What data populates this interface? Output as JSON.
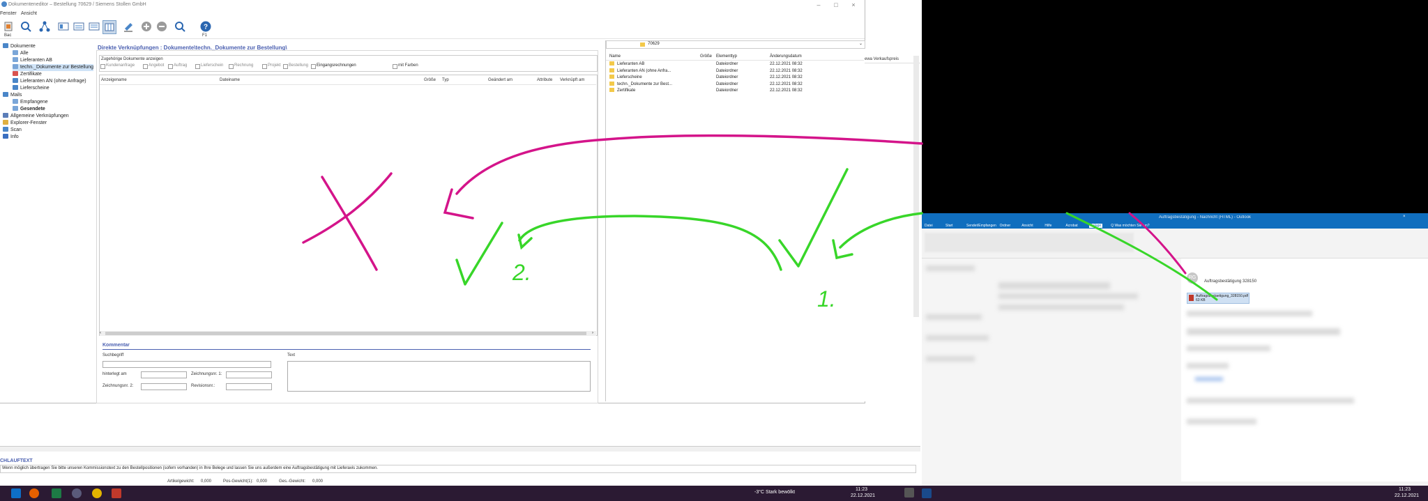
{
  "window": {
    "title": "Dokumenteneditor – Bestellung 70629 / Siemens Stollen GmbH",
    "menu": [
      "Fenster",
      "Ansicht"
    ],
    "toolbar_labels": {
      "bac": "Bac",
      "f1": "F1"
    }
  },
  "tree": {
    "items": [
      {
        "label": "Dokumente",
        "level": 0,
        "color": "#4a86c8"
      },
      {
        "label": "Alle",
        "level": 1,
        "color": "#7aa6d8"
      },
      {
        "label": "Lieferanten AB",
        "level": 1,
        "color": "#7aa6d8"
      },
      {
        "label": "techn._Dokumente zur Bestellung",
        "level": 1,
        "color": "#7aa6d8",
        "selected": true
      },
      {
        "label": "Zertifikate",
        "level": 1,
        "color": "#d9534f"
      },
      {
        "label": "Lieferanten AN (ohne Anfrage)",
        "level": 1,
        "color": "#4a86c8"
      },
      {
        "label": "Lieferscheine",
        "level": 1,
        "color": "#4a86c8"
      },
      {
        "label": "Mails",
        "level": 0,
        "color": "#4a86c8"
      },
      {
        "label": "Empfangene",
        "level": 1,
        "color": "#7aa6d8"
      },
      {
        "label": "Gesendete",
        "level": 1,
        "color": "#7aa6d8",
        "bold": true
      },
      {
        "label": "Allgemeine Verknüpfungen",
        "level": 0,
        "color": "#5b7db8"
      },
      {
        "label": "Explorer-Fenster",
        "level": 0,
        "color": "#e0b040"
      },
      {
        "label": "Scan",
        "level": 0,
        "color": "#4a86c8"
      },
      {
        "label": "Info",
        "level": 0,
        "color": "#3a6fc0"
      }
    ]
  },
  "panel": {
    "title": "Direkte Verknüpfungen : Dokumente\\techn._Dokumente zur Bestellung\\",
    "filter_caption": "Zugehörige Dokumente anzeigen",
    "filters": [
      "Kundenanfrage",
      "Angebot",
      "Auftrag",
      "Lieferschein",
      "Rechnung",
      "Projekt",
      "Bestellung",
      "Eingangsrechnungen"
    ],
    "with_colors": "mit Farben",
    "columns": [
      "Anzeigename",
      "Dateiname",
      "Größe",
      "Typ",
      "Geändert am",
      "Attribute",
      "Verknüpft am"
    ],
    "comment": {
      "header": "Kommentar",
      "search_label": "Suchbegriff",
      "text_label": "Text",
      "filed_label": "hinterlegt am",
      "drawing1_label": "Zeichnungsnr. 1:",
      "drawing2_label": "Zeichnungsnr. 2:",
      "revision_label": "Revisionsnr.:"
    }
  },
  "explorer": {
    "path": "70629",
    "columns": [
      "Name",
      "Größe",
      "Elementtyp",
      "Änderungsdatum"
    ],
    "rows": [
      {
        "name": "Lieferanten AB",
        "type": "Dateiordner",
        "date": "22.12.2021 08:32"
      },
      {
        "name": "Lieferanten AN (ohne Anfra...",
        "type": "Dateiordner",
        "date": "22.12.2021 08:32"
      },
      {
        "name": "Lieferscheine",
        "type": "Dateiordner",
        "date": "22.12.2021 08:32"
      },
      {
        "name": "techn._Dokumente zur Best...",
        "type": "Dateiordner",
        "date": "22.12.2021 08:32"
      },
      {
        "name": "Zertifikate",
        "type": "Dateiordner",
        "date": "22.12.2021 08:32"
      }
    ]
  },
  "bg_right_column": "ewa Verkaufspreis",
  "bottom": {
    "header": "CHLAUFTEXT",
    "text": "Wenn möglich übertragen Sie bitte unseren Kommissionstext zu den Bestellpositionen (sofern vorhanden) in Ihre Belege und lassen Sie uns außerdem eine Auftragsbestätigung mit Lieferavis zukommen.",
    "status": [
      {
        "label": "Artikelgewicht:",
        "value": "0,000"
      },
      {
        "label": "Pos-Gewicht(1):",
        "value": "0,000"
      },
      {
        "label": "Ges.-Gewicht:",
        "value": "0,000"
      }
    ]
  },
  "outlook": {
    "title": "Auftragsbestätigung - Nachricht (HTML) - Outlook",
    "tabs": [
      "Datei",
      "Start",
      "Sendet/Empfangen",
      "Ordner",
      "Ansicht",
      "Hilfe",
      "Acrobat",
      "Anlage",
      "Q Was möchten Sie tun?"
    ],
    "subject": "Auftragsbestätigung 328150",
    "attachment": "Auftragsbestaetigung_328150.pdf",
    "attachment_size": "63 KB",
    "avatar": "RG"
  },
  "annotations": {
    "mark_2": "2.",
    "mark_1": "1."
  },
  "taskbar": {
    "weather": "-3°C  Stark bewölkt",
    "time": "11:23",
    "date": "22.12.2021",
    "time2": "11:23",
    "date2": "22.12.2021"
  },
  "colors": {
    "annotation_magenta": "#d4148a",
    "annotation_green": "#38d629",
    "outlook_blue": "#106ebe",
    "taskbar": "#2b1a33"
  }
}
